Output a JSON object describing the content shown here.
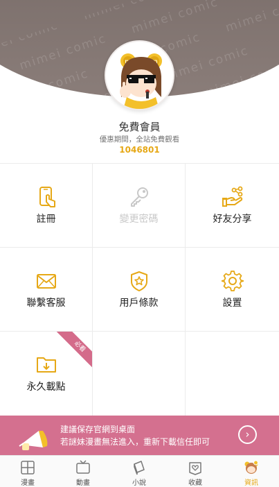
{
  "header": {
    "watermark_text": "mimei comic",
    "member_title": "免費會員",
    "member_subtitle": "優惠期間，全站免費觀看",
    "member_id": "1046801"
  },
  "menu": {
    "items": [
      {
        "label": "註冊",
        "icon": "phone-tap-icon",
        "enabled": true
      },
      {
        "label": "變更密碼",
        "icon": "key-icon",
        "enabled": false
      },
      {
        "label": "好友分享",
        "icon": "share-hand-icon",
        "enabled": true
      },
      {
        "label": "聯繫客服",
        "icon": "mail-icon",
        "enabled": true
      },
      {
        "label": "用戶條款",
        "icon": "shield-star-icon",
        "enabled": true
      },
      {
        "label": "設置",
        "icon": "gear-icon",
        "enabled": true
      },
      {
        "label": "永久載點",
        "icon": "folder-download-icon",
        "enabled": true,
        "badge": "必看"
      }
    ]
  },
  "banner": {
    "line1": "建議保存官網到桌面",
    "line2": "若謎妹漫畫無法進入，重新下載信任即可",
    "arrow": "›"
  },
  "tabbar": {
    "tabs": [
      {
        "label": "漫畫",
        "icon": "grid-book-icon",
        "active": false
      },
      {
        "label": "動畫",
        "icon": "tv-icon",
        "active": false
      },
      {
        "label": "小說",
        "icon": "novel-book-icon",
        "active": false
      },
      {
        "label": "收藏",
        "icon": "heart-frame-icon",
        "active": false
      },
      {
        "label": "資訊",
        "icon": "profile-avatar-icon",
        "active": true
      }
    ]
  },
  "colors": {
    "accent": "#e6a816",
    "banner": "#d4708f",
    "hero": "#7a6e6b",
    "disabled": "#c8c8c8"
  }
}
